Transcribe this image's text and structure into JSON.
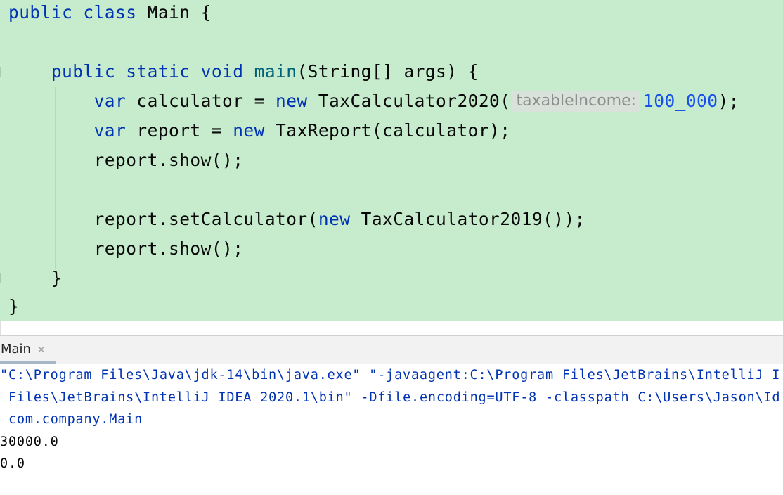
{
  "editor": {
    "line1": {
      "kw1": "public",
      "kw2": "class",
      "name": "Main",
      "brace": "{"
    },
    "line3": {
      "kw1": "public",
      "kw2": "static",
      "kw3": "void",
      "fn": "main",
      "rest": "(String[] args) {"
    },
    "line4": {
      "kw": "var",
      "mid": "calculator = ",
      "kw_new": "new",
      "cls": "TaxCalculator2020(",
      "hint": "taxableIncome:",
      "num": "100_000",
      "end": ");"
    },
    "line5": {
      "kw": "var",
      "mid": "report = ",
      "kw_new": "new",
      "rest": "TaxReport(calculator);"
    },
    "line6": "report.show();",
    "line8": {
      "start": "report.setCalculator(",
      "kw_new": "new",
      "rest": "TaxCalculator2019());"
    },
    "line9": "report.show();",
    "line10": "}",
    "line11": "}"
  },
  "run_panel": {
    "tab_label": "Main",
    "close_glyph": "×"
  },
  "console": {
    "cmd_line1": "\"C:\\Program Files\\Java\\jdk-14\\bin\\java.exe\" \"-javaagent:C:\\Program Files\\JetBrains\\IntelliJ I",
    "cmd_line2": "Files\\JetBrains\\IntelliJ IDEA 2020.1\\bin\" -Dfile.encoding=UTF-8 -classpath C:\\Users\\Jason\\Id",
    "cmd_line3": "com.company.Main",
    "out_line1": "30000.0",
    "out_line2": "0.0"
  },
  "colors": {
    "editor_bg": "#c7ebcd",
    "keyword": "#0033b3",
    "method": "#00627a",
    "number": "#1750eb",
    "hint_text": "#8c8c8c"
  }
}
